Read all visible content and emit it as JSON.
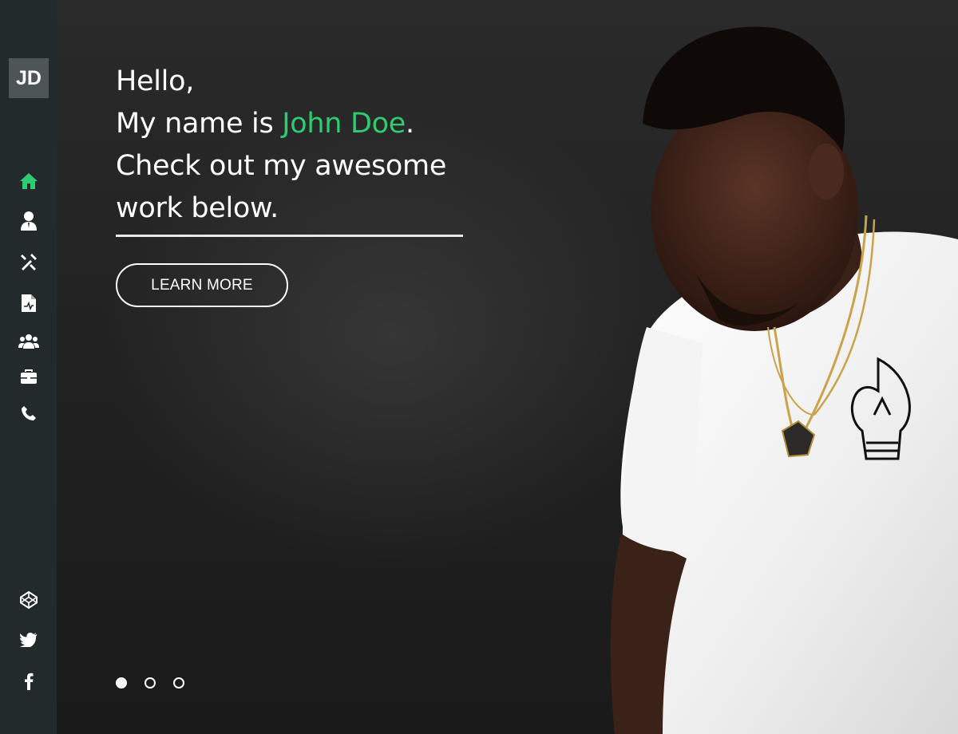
{
  "sidebar": {
    "logo": "JD",
    "nav": [
      {
        "name": "home-icon",
        "active": true
      },
      {
        "name": "user-icon",
        "active": false
      },
      {
        "name": "tools-icon",
        "active": false
      },
      {
        "name": "resume-icon",
        "active": false
      },
      {
        "name": "team-icon",
        "active": false
      },
      {
        "name": "briefcase-icon",
        "active": false
      },
      {
        "name": "phone-icon",
        "active": false
      }
    ],
    "social": [
      {
        "name": "codepen-icon"
      },
      {
        "name": "twitter-icon"
      },
      {
        "name": "facebook-icon"
      }
    ]
  },
  "hero": {
    "line1": "Hello,",
    "line2_prefix": "My name is ",
    "line2_name": "John Doe",
    "line2_suffix": ".",
    "line3": "Check out my awesome",
    "line4": "work below.",
    "button_label": "LEARN MORE",
    "slides": [
      {
        "active": true
      },
      {
        "active": false
      },
      {
        "active": false
      }
    ]
  },
  "colors": {
    "accent": "#2ecc71",
    "sidebar_bg": "#232a2c",
    "logo_bg": "#4e5557",
    "icon": "#ffffff"
  }
}
